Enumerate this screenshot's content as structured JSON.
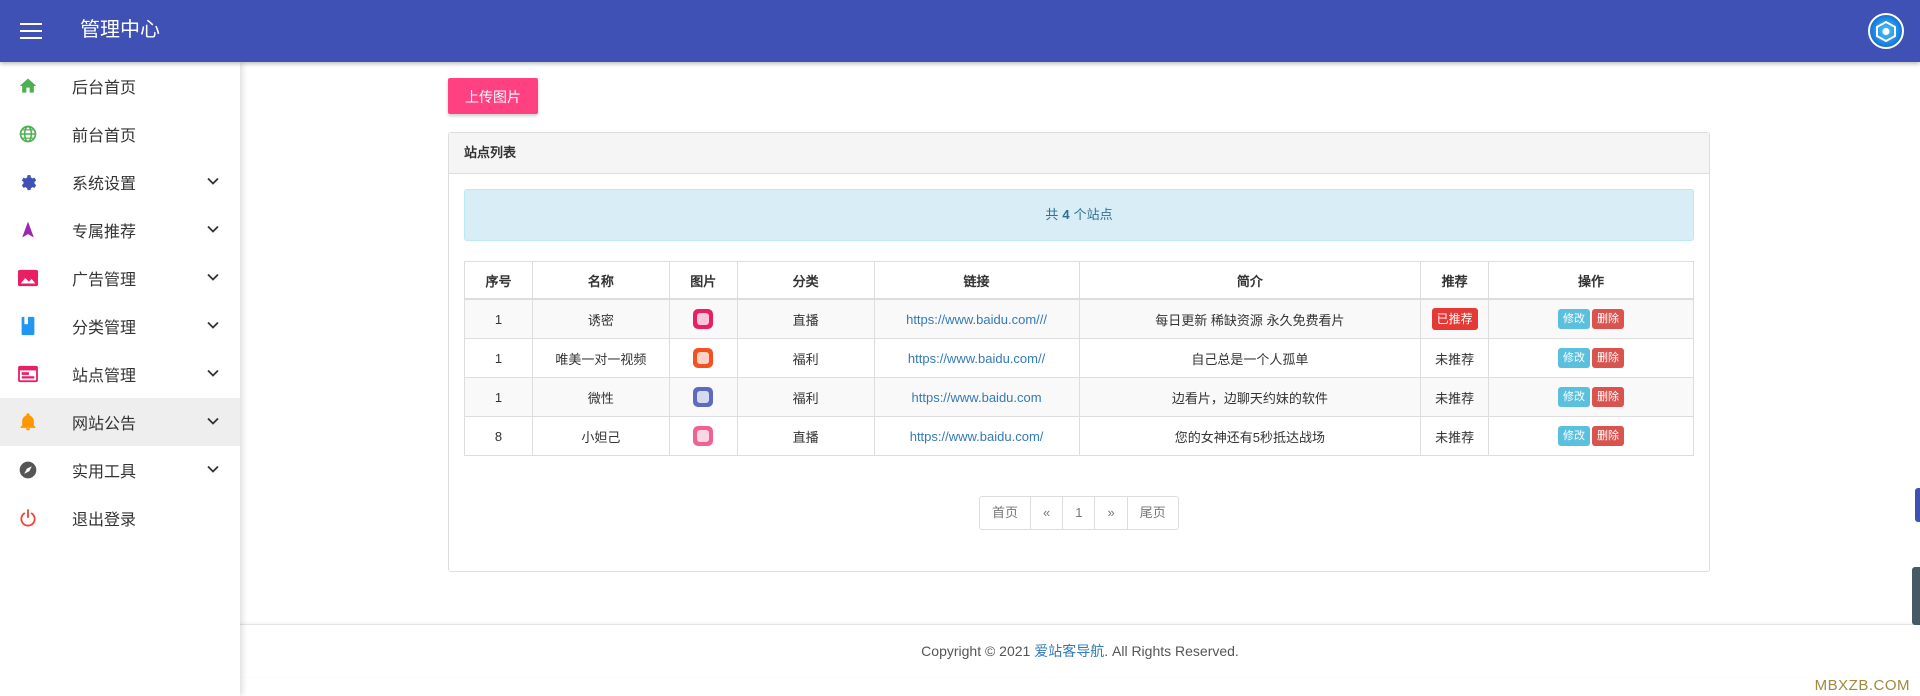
{
  "header": {
    "title": "管理中心",
    "menu_icon": "hamburger-icon",
    "avatar_icon": "avatar-icon",
    "color": "#3f51b5"
  },
  "sidebar": {
    "items": [
      {
        "label": "后台首页",
        "icon": "home-icon",
        "color": "#4caf50"
      },
      {
        "label": "前台首页",
        "icon": "globe-icon",
        "color": "#4caf50"
      },
      {
        "label": "系统设置",
        "icon": "gear-icon",
        "color": "#3f51b5"
      },
      {
        "label": "专属推荐",
        "icon": "navigation-icon",
        "color": "#9c27b0"
      },
      {
        "label": "广告管理",
        "icon": "image-icon",
        "color": "#e91e63"
      },
      {
        "label": "分类管理",
        "icon": "book-icon",
        "color": "#2196f3"
      },
      {
        "label": "站点管理",
        "icon": "web-icon",
        "color": "#e91e63"
      },
      {
        "label": "网站公告",
        "icon": "bell-icon",
        "color": "#ff9800"
      },
      {
        "label": "实用工具",
        "icon": "compass-icon",
        "color": "#555555"
      },
      {
        "label": "退出登录",
        "icon": "power-icon",
        "color": "#f44336"
      }
    ]
  },
  "main": {
    "upload_label": "上传图片",
    "panel_title": "站点列表",
    "alert": {
      "prefix": "共",
      "count": "4",
      "suffix": "个站点"
    },
    "table": {
      "headers": [
        "序号",
        "名称",
        "图片",
        "分类",
        "链接",
        "简介",
        "推荐",
        "操作"
      ],
      "rows": [
        {
          "id": "1",
          "name": "诱密",
          "thumb_color": "#e91e63",
          "category": "直播",
          "link": "https://www.baidu.com///",
          "desc": "每日更新 稀缺资源 永久免费看片",
          "rec": "已推荐",
          "recommended": true
        },
        {
          "id": "1",
          "name": "唯美一对一视频",
          "thumb_color": "#f4511e",
          "category": "福利",
          "link": "https://www.baidu.com//",
          "desc": "自己总是一个人孤单",
          "rec": "未推荐",
          "recommended": false
        },
        {
          "id": "1",
          "name": "微性",
          "thumb_color": "#5c6bc0",
          "category": "福利",
          "link": "https://www.baidu.com",
          "desc": "边看片，边聊天约妹的软件",
          "rec": "未推荐",
          "recommended": false
        },
        {
          "id": "8",
          "name": "小妲己",
          "thumb_color": "#f06292",
          "category": "直播",
          "link": "https://www.baidu.com/",
          "desc": "您的女神还有5秒抵达战场",
          "rec": "未推荐",
          "recommended": false
        }
      ],
      "edit_label": "修改",
      "delete_label": "删除"
    },
    "pager": {
      "first": "首页",
      "prev": "«",
      "page": "1",
      "next": "»",
      "last": "尾页"
    }
  },
  "footer": {
    "prefix": "Copyright © 2021 ",
    "link": "爱站客导航",
    "suffix": ". All Rights Reserved.",
    "watermark": "MBXZB.COM"
  }
}
